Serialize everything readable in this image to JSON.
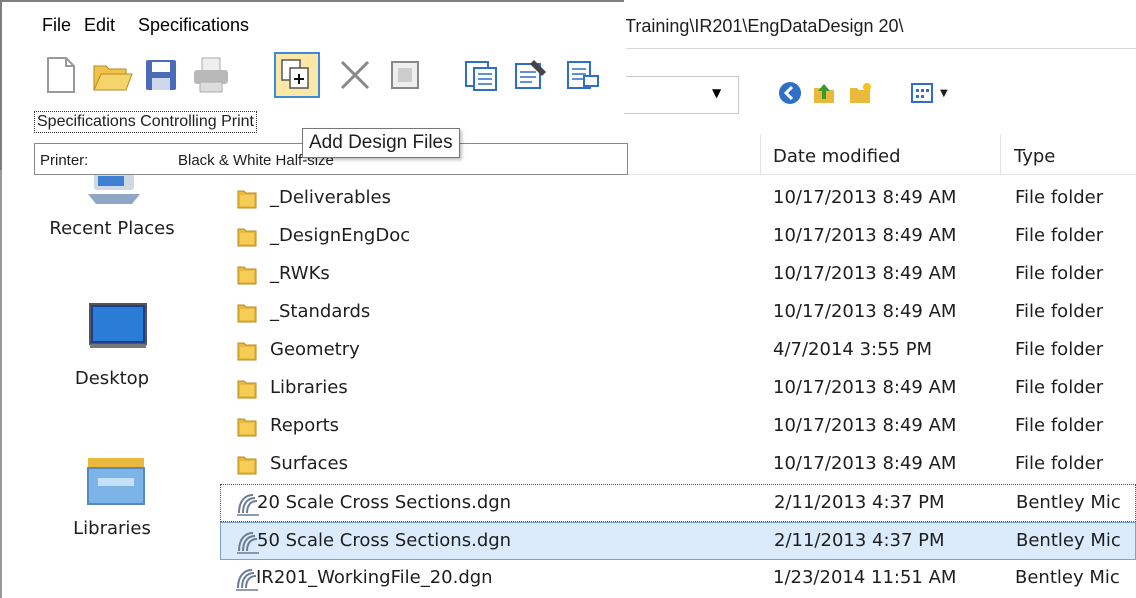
{
  "menu": {
    "file": "File",
    "edit": "Edit",
    "specifications": "Specifications"
  },
  "address_path": "Training\\IR201\\EngDataDesign 20\\",
  "toolbar_buttons": [
    "new-icon",
    "open-folder-icon",
    "save-icon",
    "print-icon",
    "add-design-files-icon",
    "delete-icon",
    "box-icon",
    "copy-spec-icon",
    "edit-spec-icon",
    "spec-list-icon"
  ],
  "spec_group_label": "Specifications Controlling Print",
  "printer_label": "Printer:",
  "printer_value": "Black & White Half-size",
  "tooltip": "Add Design Files",
  "columns": {
    "date": "Date modified",
    "type": "Type"
  },
  "nav": [
    {
      "label": "Recent Places",
      "icon": "recent-places-icon"
    },
    {
      "label": "Desktop",
      "icon": "desktop-icon"
    },
    {
      "label": "Libraries",
      "icon": "libraries-icon"
    }
  ],
  "files": [
    {
      "name": "_Deliverables",
      "date": "10/17/2013 8:49 AM",
      "type": "File folder",
      "icon": "folder-icon"
    },
    {
      "name": "_DesignEngDoc",
      "date": "10/17/2013 8:49 AM",
      "type": "File folder",
      "icon": "folder-icon"
    },
    {
      "name": "_RWKs",
      "date": "10/17/2013 8:49 AM",
      "type": "File folder",
      "icon": "folder-icon"
    },
    {
      "name": "_Standards",
      "date": "10/17/2013 8:49 AM",
      "type": "File folder",
      "icon": "folder-icon"
    },
    {
      "name": "Geometry",
      "date": "4/7/2014 3:55 PM",
      "type": "File folder",
      "icon": "folder-icon"
    },
    {
      "name": "Libraries",
      "date": "10/17/2013 8:49 AM",
      "type": "File folder",
      "icon": "folder-icon"
    },
    {
      "name": "Reports",
      "date": "10/17/2013 8:49 AM",
      "type": "File folder",
      "icon": "folder-icon"
    },
    {
      "name": "Surfaces",
      "date": "10/17/2013 8:49 AM",
      "type": "File folder",
      "icon": "folder-icon"
    },
    {
      "name": "20 Scale Cross Sections.dgn",
      "date": "2/11/2013 4:37 PM",
      "type": "Bentley Mic",
      "icon": "dgn-file-icon"
    },
    {
      "name": "50 Scale Cross Sections.dgn",
      "date": "2/11/2013 4:37 PM",
      "type": "Bentley Mic",
      "icon": "dgn-file-icon"
    },
    {
      "name": "IR201_WorkingFile_20.dgn",
      "date": "1/23/2014 11:51 AM",
      "type": "Bentley Mic",
      "icon": "dgn-file-icon"
    }
  ],
  "colors": {
    "selection_fill": "#dcebfc",
    "selection_border": "#7da2ce",
    "active_button": "#fbe8a6",
    "folder": "#e8b93c"
  }
}
